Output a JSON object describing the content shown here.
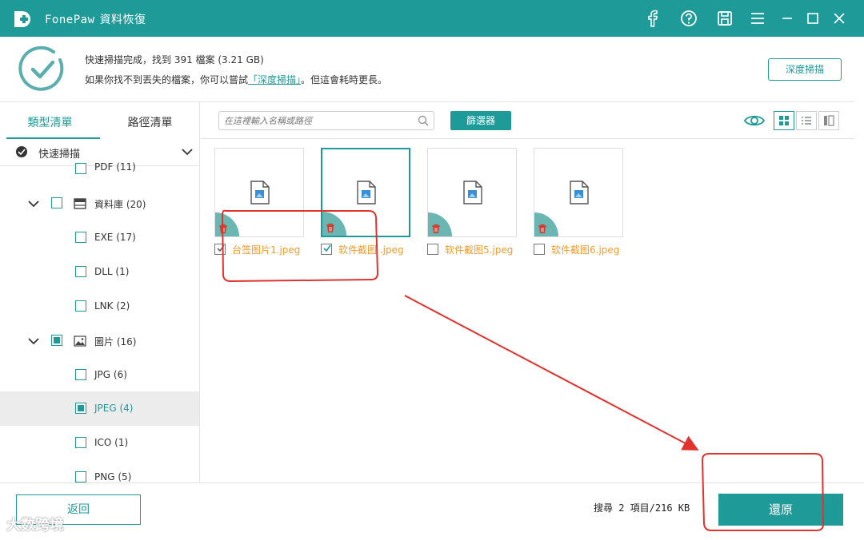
{
  "app": {
    "name": "FonePaw",
    "title_zh": "資料恢復",
    "brand_color": "#1e9a99",
    "accent_orange": "#f39c2b"
  },
  "titlebar_icons": [
    "facebook-icon",
    "help-icon",
    "save-icon",
    "menu-icon",
    "minimize-icon",
    "maximize-icon",
    "close-icon"
  ],
  "status": {
    "line1": "快速掃描完成，找到 391 檔案 (3.21 GB)",
    "line2_prefix": "如果你找不到丟失的檔案，你可以嘗試",
    "line2_link": "「深度掃描」",
    "line2_suffix": "。但這會耗時更長。",
    "deep_scan_button": "深度掃描"
  },
  "sidebar": {
    "tabs": [
      "類型清單",
      "路徑清單"
    ],
    "active_tab": 0,
    "scan_mode": "快速掃描",
    "items": [
      {
        "label": "PDF (11)",
        "level": 2,
        "checked": "none"
      },
      {
        "label": "資料庫 (20)",
        "level": 1,
        "checked": "none",
        "expanded": true,
        "icon": "database-icon"
      },
      {
        "label": "EXE (17)",
        "level": 2,
        "checked": "none"
      },
      {
        "label": "DLL (1)",
        "level": 2,
        "checked": "none"
      },
      {
        "label": "LNK (2)",
        "level": 2,
        "checked": "none"
      },
      {
        "label": "圖片 (16)",
        "level": 1,
        "checked": "partial",
        "expanded": true,
        "icon": "image-icon"
      },
      {
        "label": "JPG (6)",
        "level": 2,
        "checked": "none"
      },
      {
        "label": "JPEG (4)",
        "level": 2,
        "checked": "partial",
        "selected": true
      },
      {
        "label": "ICO (1)",
        "level": 2,
        "checked": "none"
      },
      {
        "label": "PNG (5)",
        "level": 2,
        "checked": "none"
      }
    ]
  },
  "toolbar": {
    "search_placeholder": "在這裡輸入名稱或路徑",
    "filter_button": "篩選器"
  },
  "files": [
    {
      "name": "台签图片1.jpeg",
      "checked": true
    },
    {
      "name": "软件截图 .jpeg",
      "checked": true,
      "active": true
    },
    {
      "name": "软件截图5.jpeg",
      "checked": false
    },
    {
      "name": "软件截图6.jpeg",
      "checked": false
    }
  ],
  "footer": {
    "back_button": "返回",
    "summary": "搜尋 2 項目/216 KB",
    "restore_button": "還原",
    "watermark": "大数跨境"
  },
  "annotations": {
    "color": "#e0332f"
  }
}
